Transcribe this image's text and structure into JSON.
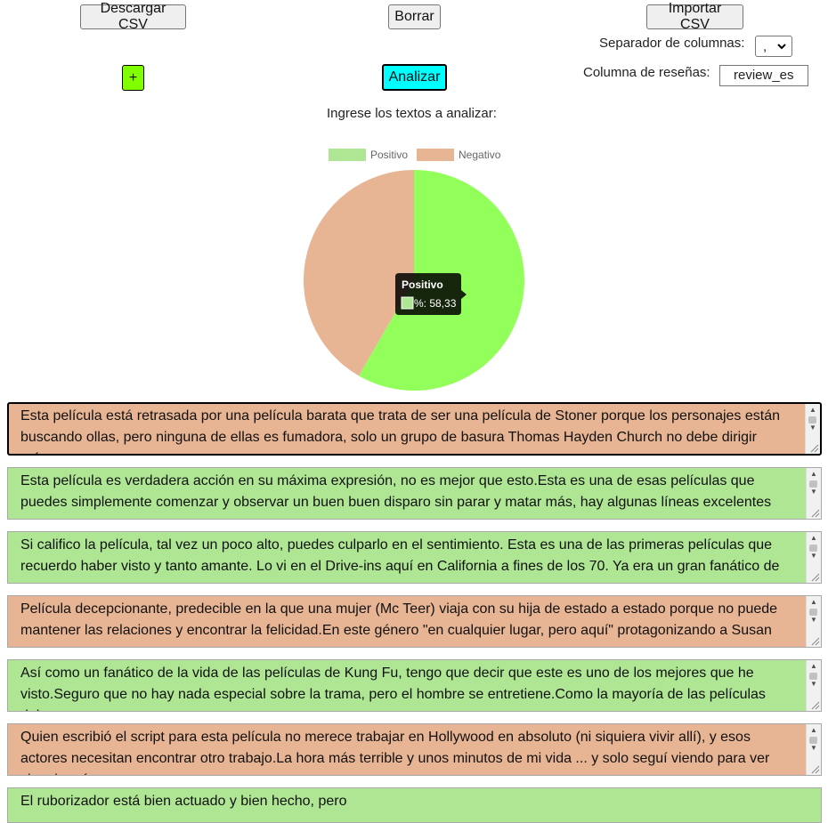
{
  "toolbar": {
    "download_label": "Descargar CSV",
    "clear_label": "Borrar",
    "import_label": "Importar CSV",
    "add_label": "+",
    "analyze_label": "Analizar"
  },
  "settings": {
    "separator_label": "Separador de columnas:",
    "separator_value": ",",
    "column_label": "Columna de reseñas:",
    "column_value": "review_es"
  },
  "prompt": "Ingrese los textos a analizar:",
  "colors": {
    "positive": "#93ff5a",
    "negative": "#e8b594",
    "positive_legend": "#afe694",
    "negative_legend": "#e8b594"
  },
  "chart_data": {
    "type": "pie",
    "categories": [
      "Positivo",
      "Negativo"
    ],
    "values": [
      58.33,
      41.67
    ],
    "legend": "top",
    "tooltip": {
      "title": "Positivo",
      "label": "%: 58,33"
    }
  },
  "reviews": [
    {
      "sentiment": "neg",
      "text": "Esta película está retrasada por una película barata que trata de ser una película de Stoner porque los personajes están buscando ollas, pero ninguna de ellas es fumadora, solo un grupo de basura Thomas Hayden Church no debe dirigir más"
    },
    {
      "sentiment": "pos",
      "text": "Esta película es verdadera acción en su máxima expresión, no es mejor que esto.Esta es una de esas películas que puedes simplemente comenzar y observar un buen buen disparo sin parar y matar más, hay algunas líneas excelentes para"
    },
    {
      "sentiment": "pos",
      "text": "Si califico la película, tal vez un poco alto, puedes culparlo en el sentimiento. Esta es una de las primeras películas que recuerdo haber visto y tanto amante. Lo vi en el Drive-ins aquí en California a fines de los 70. Ya era un gran fanático de"
    },
    {
      "sentiment": "neg",
      "text": "Película decepcionante, predecible en la que una mujer (Mc Teer) viaja con su hija de estado a estado porque no puede mantener las relaciones y encontrar la felicidad.En este género \"en cualquier lugar, pero aquí\" protagonizando a Susan"
    },
    {
      "sentiment": "pos",
      "text": "Así como un fanático de la vida de las películas de Kung Fu, tengo que decir que este es uno de los mejores que he visto.Seguro que no hay nada especial sobre la trama, pero el hombre se entretiene.Como la mayoría de las películas del"
    },
    {
      "sentiment": "neg",
      "text": "Quien escribió el script para esta película no merece trabajar en Hollywood en absoluto (ni siquiera vivir allí), y esos actores necesitan encontrar otro trabajo.La hora más terrible y unos minutos de mi vida ... y solo seguí viendo para ver si mejoraría"
    },
    {
      "sentiment": "pos",
      "text": "El ruborizador está bien actuado y bien hecho, pero"
    }
  ]
}
